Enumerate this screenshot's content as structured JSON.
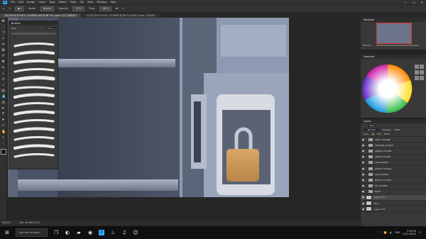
{
  "app": {
    "logo": "Ps"
  },
  "menu": [
    "File",
    "Edit",
    "Image",
    "Layer",
    "Type",
    "Select",
    "Filter",
    "3D",
    "View",
    "Window",
    "Help"
  ],
  "window_controls": [
    "—",
    "☐",
    "✕"
  ],
  "options_bar": {
    "mode_label": "Mode:",
    "mode_value": "Normal",
    "opacity_label": "Opacity:",
    "opacity_value": "100%",
    "flow_label": "Flow:",
    "flow_value": "100%"
  },
  "tabs": [
    {
      "label": "LOCATION SCHOOL LOCKERS.psd @ 66.7% (Layer 175, RGB/8) *",
      "active": true
    },
    {
      "label": "LOCATION SCHOOL LOCKERS @ 66.7% (RGB, locker, RGB/8) *",
      "active": false
    }
  ],
  "brush_panel": {
    "title": "Brushes",
    "size_label": "Size:",
    "size_value": "115 px"
  },
  "navigator_panel": {
    "title": "Navigator",
    "zoom": "66.67%"
  },
  "swatch_panel": {
    "title": "Swatches"
  },
  "layers_panel": {
    "title": "Layers",
    "kind_label": "Kind",
    "blend_mode": "Normal",
    "opacity_label": "Opacity:",
    "opacity_value": "100%",
    "lock_label": "Lock:",
    "fill_label": "Fill:",
    "fill_value": "100%",
    "layers": [
      {
        "name": "GREG LOCKER",
        "type": "group"
      },
      {
        "name": "SHONEN LOCKER",
        "type": "group"
      },
      {
        "name": "SENPAI LOCKER",
        "type": "group"
      },
      {
        "name": "ANNIE LOCKER",
        "type": "group"
      },
      {
        "name": "YEN LOCKER",
        "type": "group"
      },
      {
        "name": "JUDITH LOCKER",
        "type": "group"
      },
      {
        "name": "SUE LOCKER",
        "type": "group"
      },
      {
        "name": "BOSSY LOCKER",
        "type": "group"
      },
      {
        "name": "MC LOCKER",
        "type": "group"
      },
      {
        "name": "BASE",
        "type": "group"
      },
      {
        "name": "Layer 175",
        "type": "layer",
        "selected": true
      },
      {
        "name": "BG 2",
        "type": "layer"
      },
      {
        "name": "Layer 173",
        "type": "layer"
      }
    ]
  },
  "status_bar": {
    "zoom": "66.67%",
    "doc": "Doc: 48.9M/1.37G"
  },
  "taskbar": {
    "search_placeholder": "Type here to search",
    "time": "2:10 PM",
    "date": "2021-06-02",
    "lang": "ENG"
  },
  "colors": {
    "canvas_bg": "#4a5363",
    "locker_light": "#a6b2c8",
    "lock_body": "#c9965a",
    "ui_dark": "#323232",
    "ps_blue": "#31a8ff"
  }
}
